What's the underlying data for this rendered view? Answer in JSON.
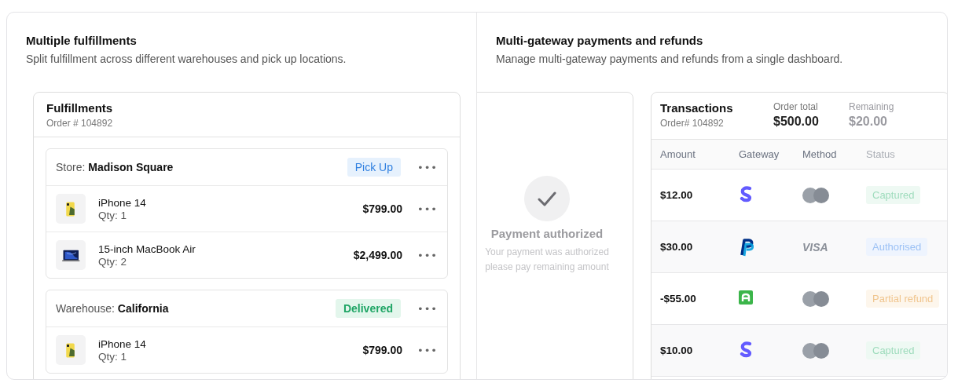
{
  "fulfillment_section": {
    "title": "Multiple fulfillments",
    "description": "Split fulfillment across different warehouses and pick up locations.",
    "card": {
      "title": "Fulfillments",
      "order": "Order # 104892",
      "groups": [
        {
          "location_label": "Store:",
          "location_name": "Madison Square",
          "badge": {
            "label": "Pick Up",
            "kind": "pickup"
          },
          "more": "•••",
          "items": [
            {
              "name": "iPhone 14",
              "qty": "Qty: 1",
              "price": "$799.00",
              "kind": "phone",
              "more": "•••"
            },
            {
              "name": "15-inch MacBook Air",
              "qty": "Qty: 2",
              "price": "$2,499.00",
              "kind": "laptop",
              "more": "•••"
            }
          ]
        },
        {
          "location_label": "Warehouse:",
          "location_name": "California",
          "badge": {
            "label": "Delivered",
            "kind": "delivered"
          },
          "more": "•••",
          "items": [
            {
              "name": "iPhone 14",
              "qty": "Qty: 1",
              "price": "$799.00",
              "kind": "phone",
              "more": "•••"
            }
          ]
        }
      ]
    }
  },
  "payments_section": {
    "title": "Multi-gateway payments and refunds",
    "description": "Manage multi-gateway payments and refunds from a single dashboard.",
    "auth_panel": {
      "title": "Payment authorized",
      "lines": [
        "Your payment was authorized",
        "please pay remaining amount"
      ]
    },
    "transactions": {
      "title": "Transactions",
      "order": "Order# 104892",
      "summary": [
        {
          "label": "Order total",
          "value": "$500.00",
          "kind": "total"
        },
        {
          "label": "Remaining",
          "value": "$20.00",
          "kind": "remaining"
        }
      ],
      "columns": [
        "Amount",
        "Gateway",
        "Method",
        "Status"
      ],
      "rows": [
        {
          "amount": "$12.00",
          "gateway": {
            "kind": "stripe"
          },
          "method": {
            "kind": "card"
          },
          "status": {
            "label": "Captured",
            "kind": "captured"
          }
        },
        {
          "amount": "$30.00",
          "gateway": {
            "kind": "paypal"
          },
          "method": {
            "kind": "visa",
            "label": "VISA"
          },
          "status": {
            "label": "Authorised",
            "kind": "authorised"
          }
        },
        {
          "amount": "-$55.00",
          "gateway": {
            "kind": "square"
          },
          "method": {
            "kind": "card"
          },
          "status": {
            "label": "Partial refund",
            "kind": "refund"
          }
        },
        {
          "amount": "$10.00",
          "gateway": {
            "kind": "stripe"
          },
          "method": {
            "kind": "card"
          },
          "status": {
            "label": "Captured",
            "kind": "captured"
          }
        }
      ]
    }
  }
}
